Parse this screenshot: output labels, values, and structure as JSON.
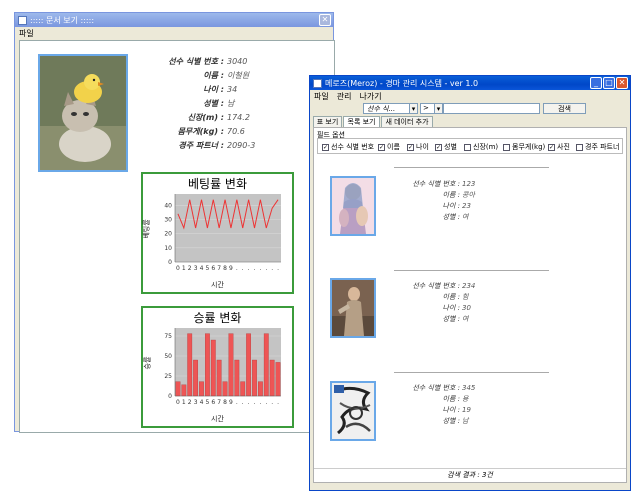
{
  "left_window": {
    "title": "::::: 문서 보기 :::::",
    "menu": [
      "파일"
    ],
    "fields": [
      {
        "label": "선수 식별 번호 :",
        "value": "3040"
      },
      {
        "label": "이름 :",
        "value": "이철원"
      },
      {
        "label": "나이 :",
        "value": "34"
      },
      {
        "label": "성별 :",
        "value": "남"
      },
      {
        "label": "신장(m) :",
        "value": "174.2"
      },
      {
        "label": "몸무게(kg) :",
        "value": "70.6"
      },
      {
        "label": "경주 파트너 :",
        "value": "2090-3"
      }
    ]
  },
  "chart_data": [
    {
      "type": "line",
      "title": "베팅률 변화",
      "xlabel": "시간",
      "ylabel": "베팅률",
      "x_ticks": [
        "0",
        "1",
        "2",
        "3",
        "4",
        "5",
        "6",
        "7",
        "8",
        "9",
        ".",
        ".",
        ".",
        ".",
        ".",
        ".",
        ".",
        "."
      ],
      "y_ticks": [
        0,
        10,
        20,
        30,
        40
      ],
      "ylim": [
        0,
        48
      ],
      "values": [
        34,
        24,
        44,
        24,
        44,
        24,
        44,
        24,
        44,
        24,
        44,
        24,
        44,
        24,
        44,
        24,
        38,
        44
      ],
      "color": "#ee3333"
    },
    {
      "type": "bar",
      "title": "승률 변화",
      "xlabel": "시간",
      "ylabel": "승률",
      "x_ticks": [
        "0",
        "1",
        "2",
        "3",
        "4",
        "5",
        "6",
        "7",
        "8",
        "9",
        ".",
        ".",
        ".",
        ".",
        ".",
        ".",
        ".",
        "."
      ],
      "y_ticks": [
        0,
        25,
        50,
        75
      ],
      "ylim": [
        0,
        85
      ],
      "values": [
        18,
        14,
        78,
        45,
        18,
        78,
        70,
        45,
        18,
        78,
        45,
        18,
        78,
        45,
        18,
        78,
        45,
        42
      ],
      "color": "#ee5555"
    }
  ],
  "right_window": {
    "title": "메로즈(Meroz) - 경마 관리 시스템 - ver 1.0",
    "menu": [
      "파일",
      "관리",
      "나가기"
    ],
    "search": {
      "field": "선수 식...",
      "op": ">",
      "value": "",
      "button": "검색"
    },
    "tabs": [
      "표 보기",
      "목록 보기",
      "새 데이터 추가"
    ],
    "active_tab": 1,
    "field_options_label": "필드 옵션",
    "checkboxes": [
      {
        "label": "선수 식별 번호",
        "checked": true
      },
      {
        "label": "이름",
        "checked": true
      },
      {
        "label": "나이",
        "checked": true
      },
      {
        "label": "성별",
        "checked": true
      },
      {
        "label": "신장(m)",
        "checked": false
      },
      {
        "label": "몸무게(kg)",
        "checked": false
      },
      {
        "label": "사진",
        "checked": true
      },
      {
        "label": "경주 파트너",
        "checked": false
      }
    ],
    "records": [
      {
        "fields": [
          {
            "label": "선수 식별 번호 :",
            "value": "123"
          },
          {
            "label": "이름 :",
            "value": "콩아"
          },
          {
            "label": "나이 :",
            "value": "23"
          },
          {
            "label": "성별 :",
            "value": "여"
          }
        ]
      },
      {
        "fields": [
          {
            "label": "선수 식별 번호 :",
            "value": "234"
          },
          {
            "label": "이름 :",
            "value": "힘"
          },
          {
            "label": "나이 :",
            "value": "30"
          },
          {
            "label": "성별 :",
            "value": "여"
          }
        ]
      },
      {
        "fields": [
          {
            "label": "선수 식별 번호 :",
            "value": "345"
          },
          {
            "label": "이름 :",
            "value": "용"
          },
          {
            "label": "나이 :",
            "value": "19"
          },
          {
            "label": "성별 :",
            "value": "남"
          }
        ]
      }
    ],
    "status": "검색 결과 : 3건"
  }
}
